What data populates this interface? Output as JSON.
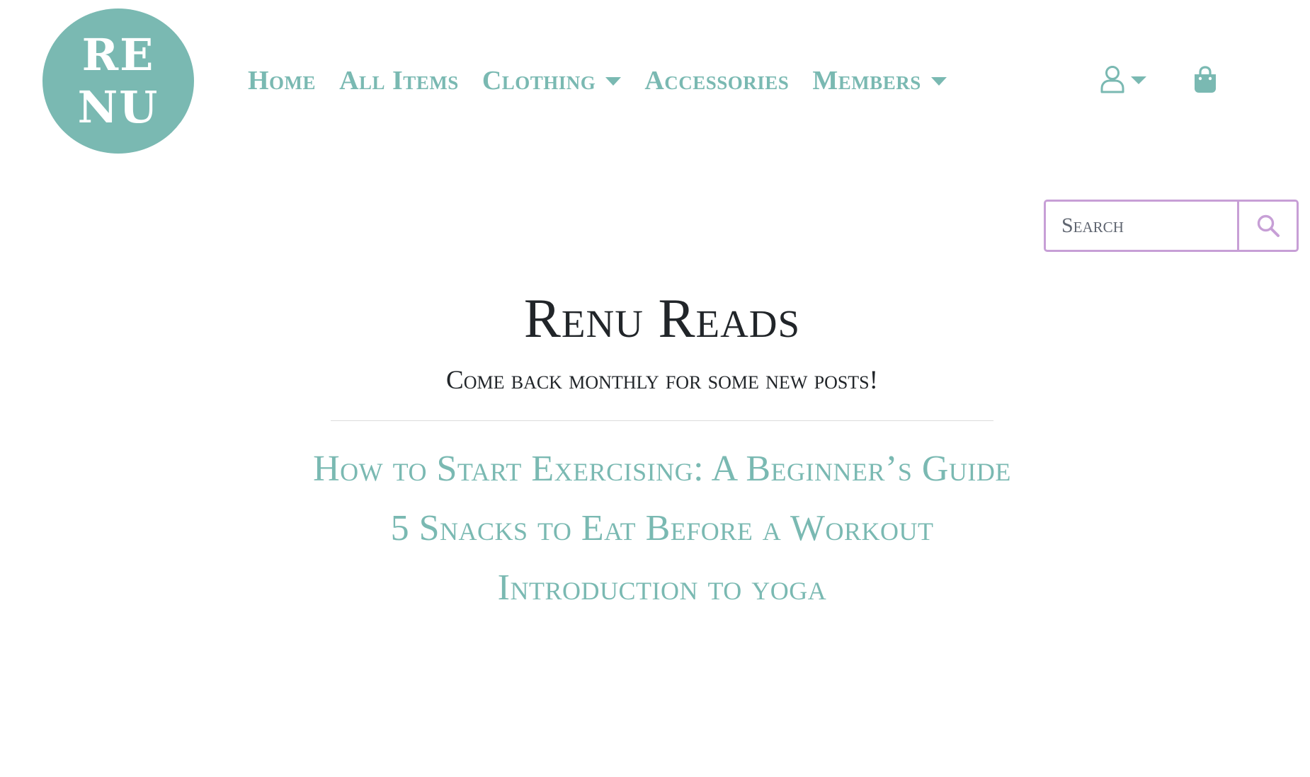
{
  "colors": {
    "accent": "#7ab9b2",
    "search_border": "#c79fd6",
    "heading": "#212529",
    "divider": "#dcdcdc"
  },
  "logo": {
    "line1": "RE",
    "line2": "NU"
  },
  "nav": {
    "items": [
      {
        "label": "Home",
        "dropdown": false
      },
      {
        "label": "All Items",
        "dropdown": false
      },
      {
        "label": "Clothing",
        "dropdown": true
      },
      {
        "label": "Accessories",
        "dropdown": false
      },
      {
        "label": "Members",
        "dropdown": true
      }
    ]
  },
  "header_icons": {
    "account": "user-icon",
    "cart": "shopping-bag-icon"
  },
  "search": {
    "placeholder": "Search",
    "button_icon": "search-icon"
  },
  "main": {
    "title": "Renu Reads",
    "subtitle": "Come back monthly for some new posts!",
    "posts": [
      "How to Start Exercising: A Beginner’s Guide",
      "5 Snacks to Eat Before a Workout",
      "Introduction to yoga"
    ]
  }
}
